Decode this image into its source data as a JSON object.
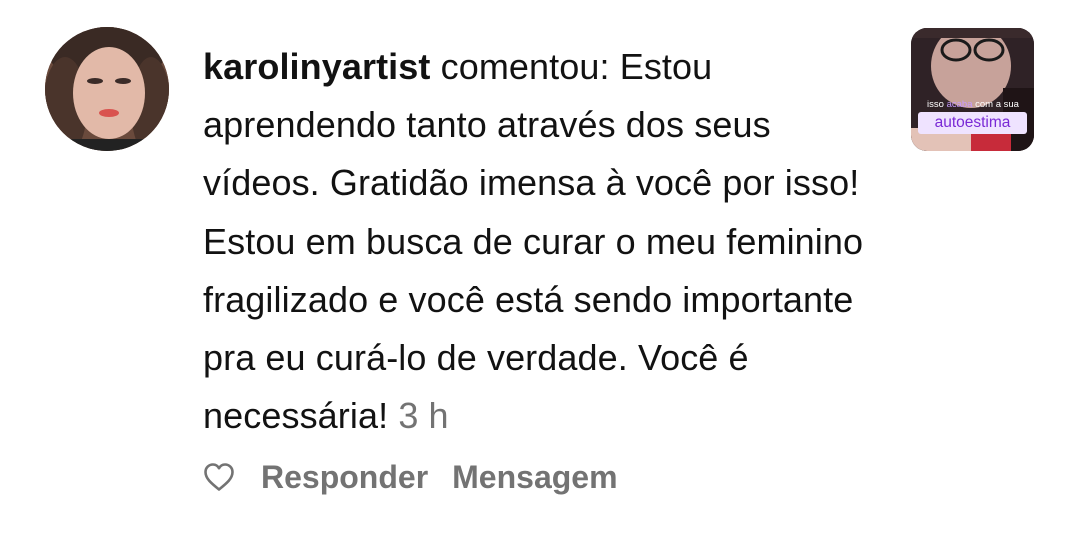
{
  "comment": {
    "username": "karolinyartist",
    "verb": "comentou:",
    "text": "Estou aprendendo tanto através dos seus vídeos. Gratidão imensa à você por isso! Estou em busca de curar o meu feminino fragilizado e você está sendo importante pra eu curá-lo de verdade. Você é necessária!",
    "time": "3 h"
  },
  "actions": {
    "like_icon": "heart-outline-icon",
    "reply_label": "Responder",
    "message_label": "Mensagem"
  },
  "thumbnail": {
    "caption_word1": "isso",
    "caption_word2": "acaba",
    "caption_rest": "com a sua",
    "label": "autoestima"
  },
  "colors": {
    "text": "#121212",
    "muted": "#737373",
    "thumb_label_bg": "#efe3ff",
    "thumb_label_text": "#7a2ad6"
  }
}
